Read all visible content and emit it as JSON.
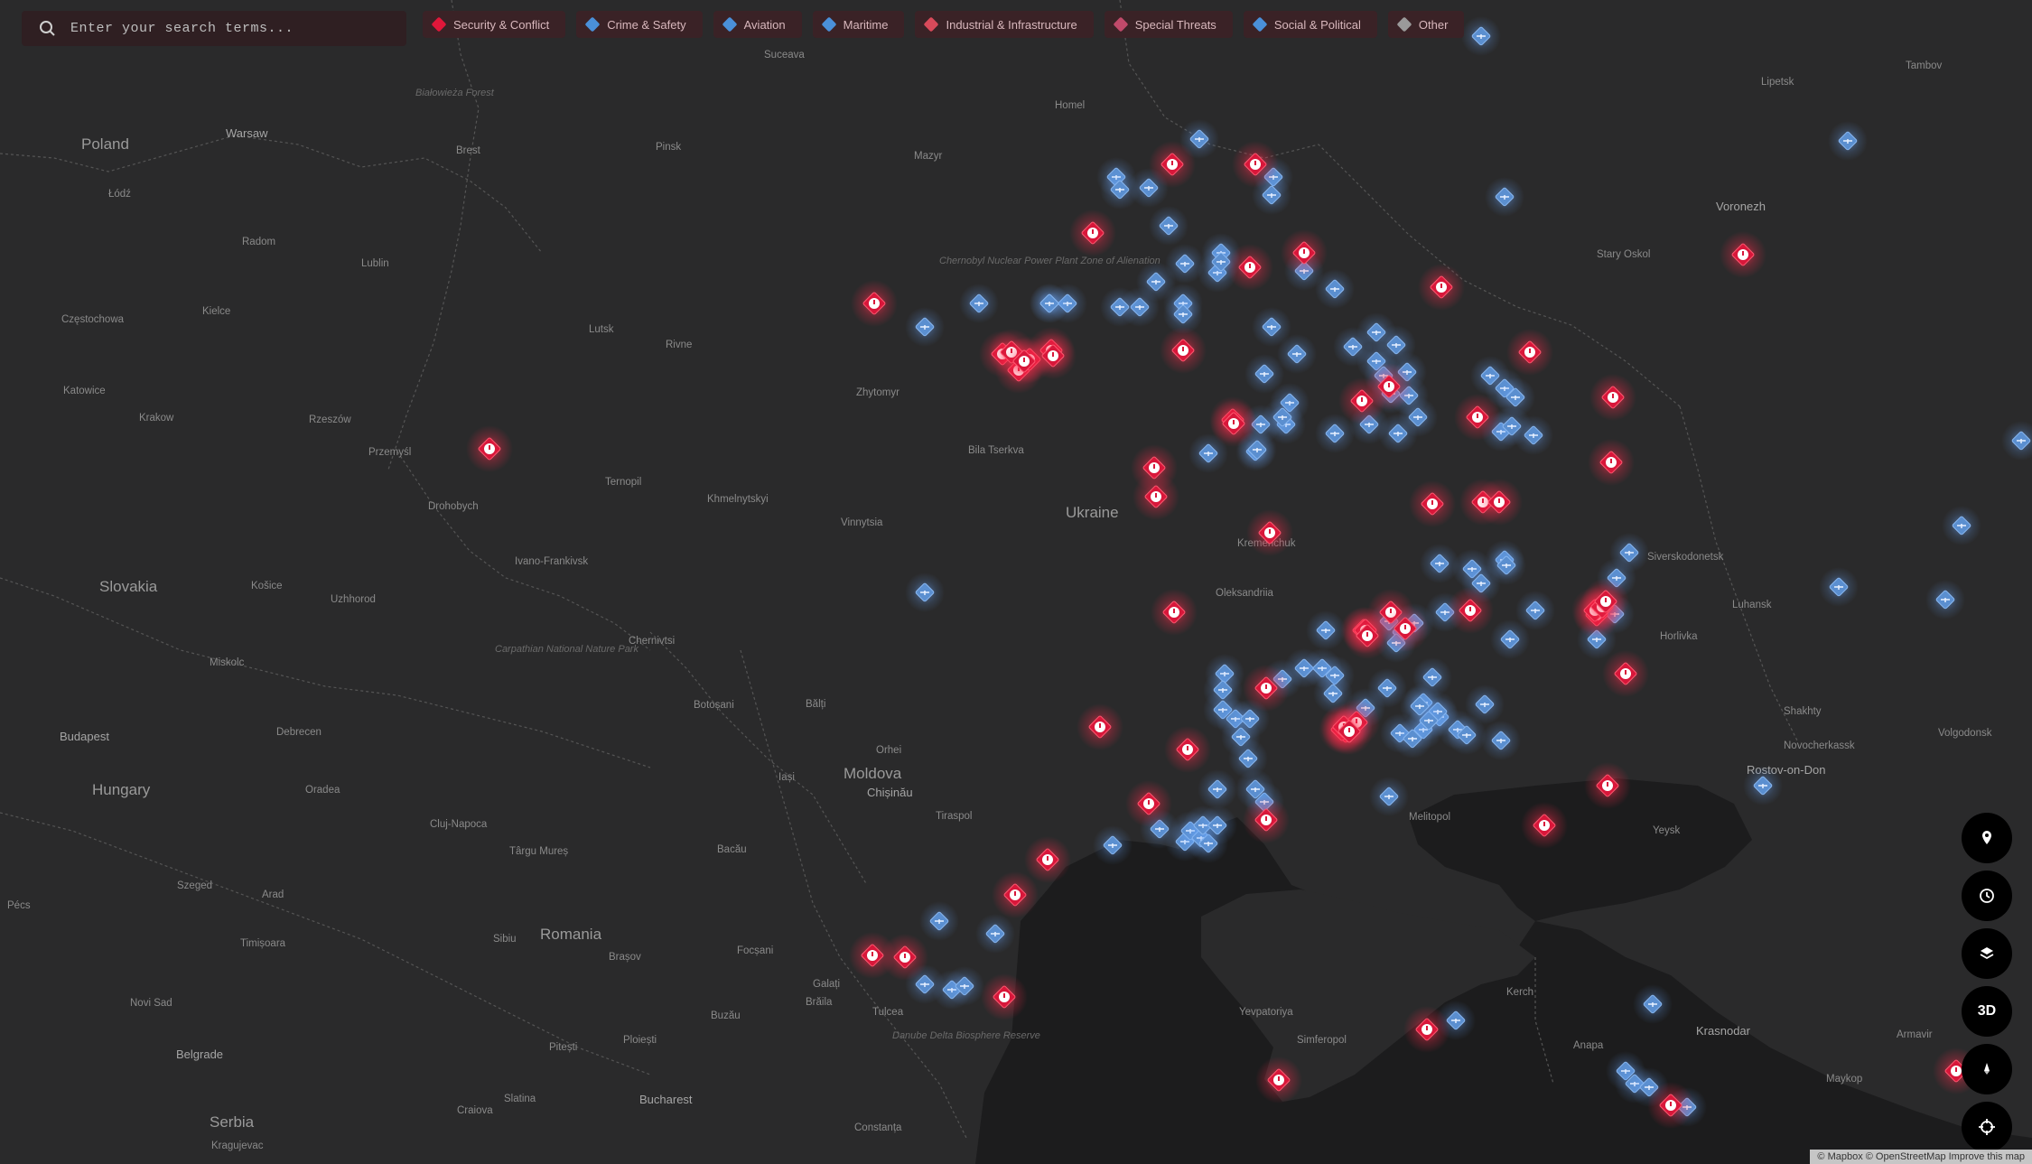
{
  "search": {
    "placeholder": "Enter your search terms..."
  },
  "filters": [
    {
      "label": "Security & Conflict",
      "color": "#e0173a"
    },
    {
      "label": "Crime & Safety",
      "color": "#4a90d9"
    },
    {
      "label": "Aviation",
      "color": "#4a90d9"
    },
    {
      "label": "Maritime",
      "color": "#4a90d9"
    },
    {
      "label": "Industrial & Infrastructure",
      "color": "#d84a5a"
    },
    {
      "label": "Special Threats",
      "color": "#c04a6a"
    },
    {
      "label": "Social & Political",
      "color": "#4a90d9"
    },
    {
      "label": "Other",
      "color": "#9a9a9a"
    }
  ],
  "controls": [
    {
      "icon": "location-pin-icon",
      "label": ""
    },
    {
      "icon": "clock-icon",
      "label": ""
    },
    {
      "icon": "layers-icon",
      "label": ""
    },
    {
      "icon": "3d-toggle",
      "label": "3D"
    },
    {
      "icon": "north-compass-icon",
      "label": ""
    },
    {
      "icon": "crosshair-locate-icon",
      "label": ""
    }
  ],
  "attribution": "© Mapbox © OpenStreetMap Improve this map",
  "place_labels": [
    {
      "text": "Poland",
      "kind": "country"
    },
    {
      "text": "Ukraine",
      "kind": "country"
    },
    {
      "text": "Hungary",
      "kind": "country"
    },
    {
      "text": "Romania",
      "kind": "country"
    },
    {
      "text": "Moldova",
      "kind": "country"
    },
    {
      "text": "Slovakia",
      "kind": "country"
    },
    {
      "text": "Serbia",
      "kind": "country"
    },
    {
      "text": "Warsaw",
      "kind": "big"
    },
    {
      "text": "Budapest",
      "kind": "big"
    },
    {
      "text": "Belgrade",
      "kind": "big"
    },
    {
      "text": "Bucharest",
      "kind": "big"
    },
    {
      "text": "Chișinău",
      "kind": "big"
    },
    {
      "text": "Voronezh",
      "kind": "big"
    },
    {
      "text": "Krasnodar",
      "kind": "big"
    },
    {
      "text": "Rostov-on-Don",
      "kind": "big"
    },
    {
      "text": "Lublin",
      "kind": "city"
    },
    {
      "text": "Lutsk",
      "kind": "city"
    },
    {
      "text": "Rivne",
      "kind": "city"
    },
    {
      "text": "Zhytomyr",
      "kind": "city"
    },
    {
      "text": "Bila Tserkva",
      "kind": "city"
    },
    {
      "text": "Ternopil",
      "kind": "city"
    },
    {
      "text": "Khmelnytskyi",
      "kind": "city"
    },
    {
      "text": "Vinnytsia",
      "kind": "city"
    },
    {
      "text": "Ivano-Frankivsk",
      "kind": "city"
    },
    {
      "text": "Chernivtsi",
      "kind": "city"
    },
    {
      "text": "Uzhhorod",
      "kind": "city"
    },
    {
      "text": "Kremenchuk",
      "kind": "city"
    },
    {
      "text": "Oleksandriia",
      "kind": "city"
    },
    {
      "text": "Melitopol",
      "kind": "city"
    },
    {
      "text": "Simferopol",
      "kind": "city"
    },
    {
      "text": "Yevpatoriya",
      "kind": "city"
    },
    {
      "text": "Kerch",
      "kind": "city"
    },
    {
      "text": "Anapa",
      "kind": "city"
    },
    {
      "text": "Maykop",
      "kind": "city"
    },
    {
      "text": "Armavir",
      "kind": "city"
    },
    {
      "text": "Shakhty",
      "kind": "city"
    },
    {
      "text": "Luhansk",
      "kind": "city"
    },
    {
      "text": "Horlivka",
      "kind": "city"
    },
    {
      "text": "Siverskodonetsk",
      "kind": "city"
    },
    {
      "text": "Stary Oskol",
      "kind": "city"
    },
    {
      "text": "Tambov",
      "kind": "city"
    },
    {
      "text": "Lipetsk",
      "kind": "city"
    },
    {
      "text": "Homel",
      "kind": "city"
    },
    {
      "text": "Pinsk",
      "kind": "city"
    },
    {
      "text": "Brest",
      "kind": "city"
    },
    {
      "text": "Mazyr",
      "kind": "city"
    },
    {
      "text": "Krakow",
      "kind": "city"
    },
    {
      "text": "Katowice",
      "kind": "city"
    },
    {
      "text": "Rzeszów",
      "kind": "city"
    },
    {
      "text": "Radom",
      "kind": "city"
    },
    {
      "text": "Łódź",
      "kind": "city"
    },
    {
      "text": "Kielce",
      "kind": "city"
    },
    {
      "text": "Częstochowa",
      "kind": "city"
    },
    {
      "text": "Przemyśl",
      "kind": "city"
    },
    {
      "text": "Drohobych",
      "kind": "city"
    },
    {
      "text": "Košice",
      "kind": "city"
    },
    {
      "text": "Miskolc",
      "kind": "city"
    },
    {
      "text": "Debrecen",
      "kind": "city"
    },
    {
      "text": "Oradea",
      "kind": "city"
    },
    {
      "text": "Cluj-Napoca",
      "kind": "city"
    },
    {
      "text": "Târgu Mureș",
      "kind": "city"
    },
    {
      "text": "Bacău",
      "kind": "city"
    },
    {
      "text": "Iași",
      "kind": "city"
    },
    {
      "text": "Bălți",
      "kind": "city"
    },
    {
      "text": "Tiraspol",
      "kind": "city"
    },
    {
      "text": "Galați",
      "kind": "city"
    },
    {
      "text": "Brăila",
      "kind": "city"
    },
    {
      "text": "Tulcea",
      "kind": "city"
    },
    {
      "text": "Constanța",
      "kind": "city"
    },
    {
      "text": "Ploiești",
      "kind": "city"
    },
    {
      "text": "Brașov",
      "kind": "city"
    },
    {
      "text": "Sibiu",
      "kind": "city"
    },
    {
      "text": "Timișoara",
      "kind": "city"
    },
    {
      "text": "Arad",
      "kind": "city"
    },
    {
      "text": "Szeged",
      "kind": "city"
    },
    {
      "text": "Novi Sad",
      "kind": "city"
    },
    {
      "text": "Pécs",
      "kind": "city"
    },
    {
      "text": "Craiova",
      "kind": "city"
    },
    {
      "text": "Slatina",
      "kind": "city"
    },
    {
      "text": "Pitești",
      "kind": "city"
    },
    {
      "text": "Focșani",
      "kind": "city"
    },
    {
      "text": "Buzău",
      "kind": "city"
    },
    {
      "text": "Orhei",
      "kind": "city"
    },
    {
      "text": "Botoșani",
      "kind": "city"
    },
    {
      "text": "Suceava",
      "kind": "city"
    },
    {
      "text": "Yeysk",
      "kind": "city"
    },
    {
      "text": "Novocherkassk",
      "kind": "city"
    },
    {
      "text": "Volgodonsk",
      "kind": "city"
    },
    {
      "text": "Kragujevac",
      "kind": "city"
    }
  ],
  "park_labels": [
    "Chernobyl Nuclear Power Plant Zone of Alienation",
    "Białowieża Forest",
    "Carpathian National Nature Park",
    "Danube Delta Biosphere Reserve"
  ],
  "markers": {
    "red_count": 64,
    "blue_count": 102
  }
}
